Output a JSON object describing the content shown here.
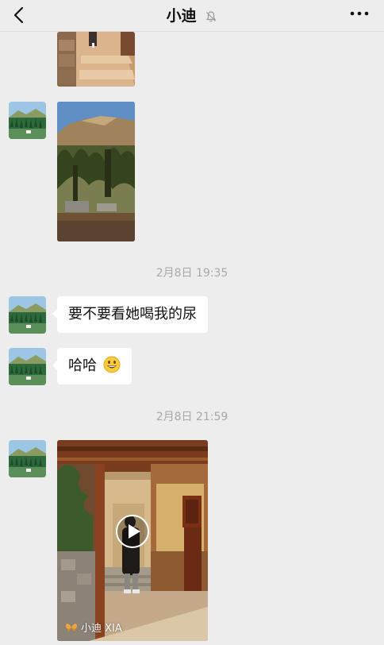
{
  "header": {
    "title": "小迪",
    "back_icon": "chevron-left-icon",
    "mute_icon": "bell-muted-icon",
    "more_icon": "more-dots-icon"
  },
  "messages": {
    "timestamp_1": "2月8日 19:35",
    "bubble_1": "要不要看她喝我的尿",
    "bubble_2": "哈哈",
    "bubble_2_emoji": "grinning-emoji",
    "timestamp_2": "2月8日 21:59"
  },
  "video": {
    "watermark": "小迪 XIA",
    "play_icon": "play-icon"
  }
}
